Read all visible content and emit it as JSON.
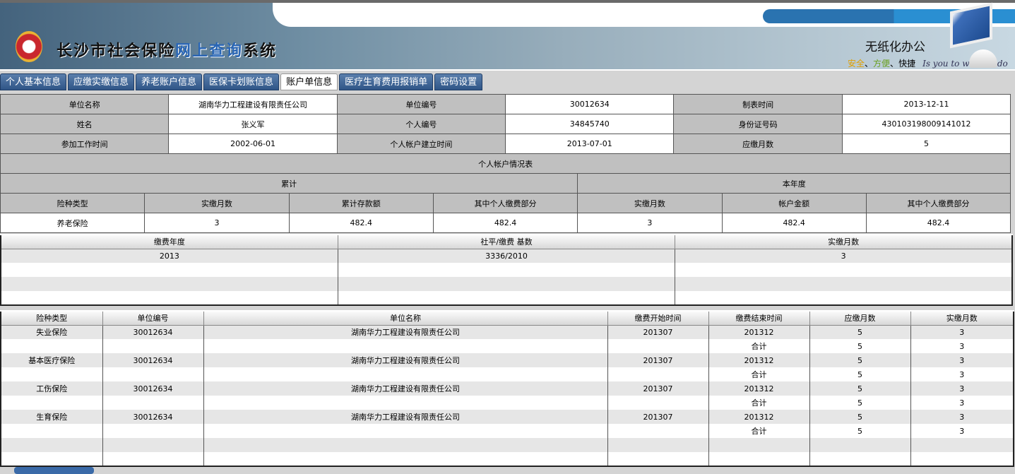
{
  "header": {
    "title_part1": "长沙市社会保险",
    "title_part2": "网上查询",
    "title_part3": "系统",
    "slogan": "无纸化办公",
    "tag_safe": "安全",
    "tag_sep1": "、",
    "tag_convenient": "方便",
    "tag_sep2": "、",
    "tag_fast": "快捷",
    "tag_en": "Is you to want to do"
  },
  "tabs": [
    {
      "label": "个人基本信息"
    },
    {
      "label": "应缴实缴信息"
    },
    {
      "label": "养老账户信息"
    },
    {
      "label": "医保卡划账信息"
    },
    {
      "label": "账户单信息",
      "active": true
    },
    {
      "label": "医疗生育费用报销单"
    },
    {
      "label": "密码设置"
    }
  ],
  "info": {
    "rows": [
      [
        "单位名称",
        "湖南华力工程建设有限责任公司",
        "单位编号",
        "30012634",
        "制表时间",
        "2013-12-11"
      ],
      [
        "姓名",
        "张义军",
        "个人编号",
        "34845740",
        "身份证号码",
        "430103198009141012"
      ],
      [
        "参加工作时间",
        "2002-06-01",
        "个人帐户建立时间",
        "2013-07-01",
        "应缴月数",
        "5"
      ]
    ],
    "section_title": "个人帐户情况表",
    "group_cumulative": "累计",
    "group_year": "本年度",
    "columns": [
      "险种类型",
      "实缴月数",
      "累计存款额",
      "其中个人缴费部分",
      "实缴月数",
      "帐户金额",
      "其中个人缴费部分"
    ],
    "data": [
      [
        "养老保险",
        "3",
        "482.4",
        "482.4",
        "3",
        "482.4",
        "482.4"
      ]
    ]
  },
  "grid1": {
    "columns": [
      "缴费年度",
      "社平/缴费 基数",
      "实缴月数"
    ],
    "rows": [
      [
        "2013",
        "3336/2010",
        "3"
      ],
      [
        "",
        "",
        ""
      ],
      [
        "",
        "",
        ""
      ],
      [
        "",
        "",
        ""
      ]
    ]
  },
  "grid2": {
    "columns": [
      "险种类型",
      "单位编号",
      "单位名称",
      "缴费开始时间",
      "缴费结束时间",
      "应缴月数",
      "实缴月数"
    ],
    "rows": [
      [
        "失业保险",
        "30012634",
        "湖南华力工程建设有限责任公司",
        "201307",
        "201312",
        "5",
        "3"
      ],
      [
        "",
        "",
        "",
        "",
        "合计",
        "5",
        "3"
      ],
      [
        "基本医疗保险",
        "30012634",
        "湖南华力工程建设有限责任公司",
        "201307",
        "201312",
        "5",
        "3"
      ],
      [
        "",
        "",
        "",
        "",
        "合计",
        "5",
        "3"
      ],
      [
        "工伤保险",
        "30012634",
        "湖南华力工程建设有限责任公司",
        "201307",
        "201312",
        "5",
        "3"
      ],
      [
        "",
        "",
        "",
        "",
        "合计",
        "5",
        "3"
      ],
      [
        "生育保险",
        "30012634",
        "湖南华力工程建设有限责任公司",
        "201307",
        "201312",
        "5",
        "3"
      ],
      [
        "",
        "",
        "",
        "",
        "合计",
        "5",
        "3"
      ],
      [
        "",
        "",
        "",
        "",
        "",
        "",
        ""
      ],
      [
        "",
        "",
        "",
        "",
        "",
        "",
        ""
      ]
    ]
  }
}
